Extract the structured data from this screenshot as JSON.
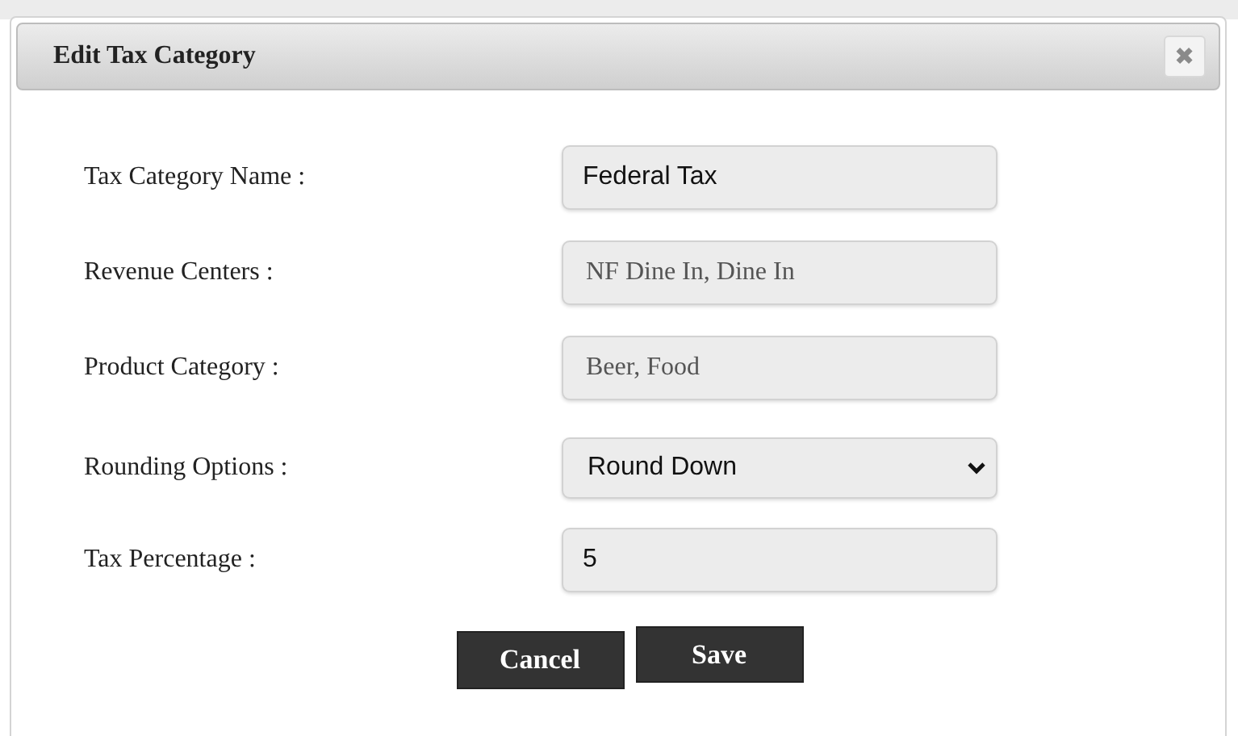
{
  "dialog": {
    "title": "Edit Tax Category",
    "close": "✖"
  },
  "fields": [
    {
      "label": "Tax Category Name :",
      "kind": "text",
      "value": "Federal Tax"
    },
    {
      "label": "Revenue Centers :",
      "kind": "multi",
      "value": "NF Dine In, Dine In"
    },
    {
      "label": "Product Category :",
      "kind": "multi",
      "value": "Beer, Food"
    },
    {
      "label": "Rounding Options :",
      "kind": "select",
      "value": "Round Down"
    },
    {
      "label": "Tax Percentage :",
      "kind": "text",
      "value": "5"
    }
  ],
  "buttons": [
    {
      "label": "Cancel",
      "kind": "secondary"
    },
    {
      "label": "Save",
      "kind": "primary"
    }
  ]
}
